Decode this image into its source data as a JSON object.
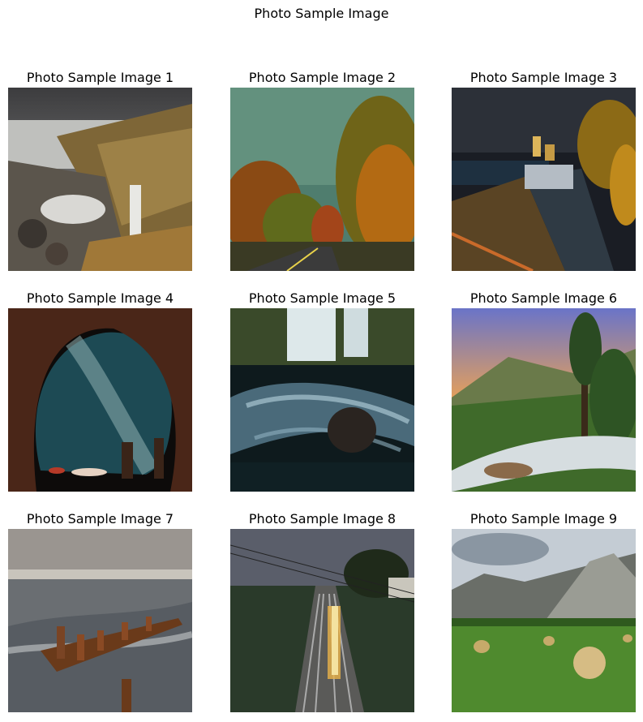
{
  "figure": {
    "suptitle": "Photo Sample Image",
    "panels": [
      {
        "title": "Photo Sample Image 1",
        "subject": "rocky-coast-waterfall"
      },
      {
        "title": "Photo Sample Image 2",
        "subject": "autumn-road"
      },
      {
        "title": "Photo Sample Image 3",
        "subject": "night-waterfront-palms"
      },
      {
        "title": "Photo Sample Image 4",
        "subject": "milky-way-cave"
      },
      {
        "title": "Photo Sample Image 5",
        "subject": "long-exposure-waterfall"
      },
      {
        "title": "Photo Sample Image 6",
        "subject": "sunset-mountain-river"
      },
      {
        "title": "Photo Sample Image 7",
        "subject": "sea-groyne-posts"
      },
      {
        "title": "Photo Sample Image 8",
        "subject": "railway-night-train"
      },
      {
        "title": "Photo Sample Image 9",
        "subject": "hay-bales-mountains"
      }
    ]
  }
}
